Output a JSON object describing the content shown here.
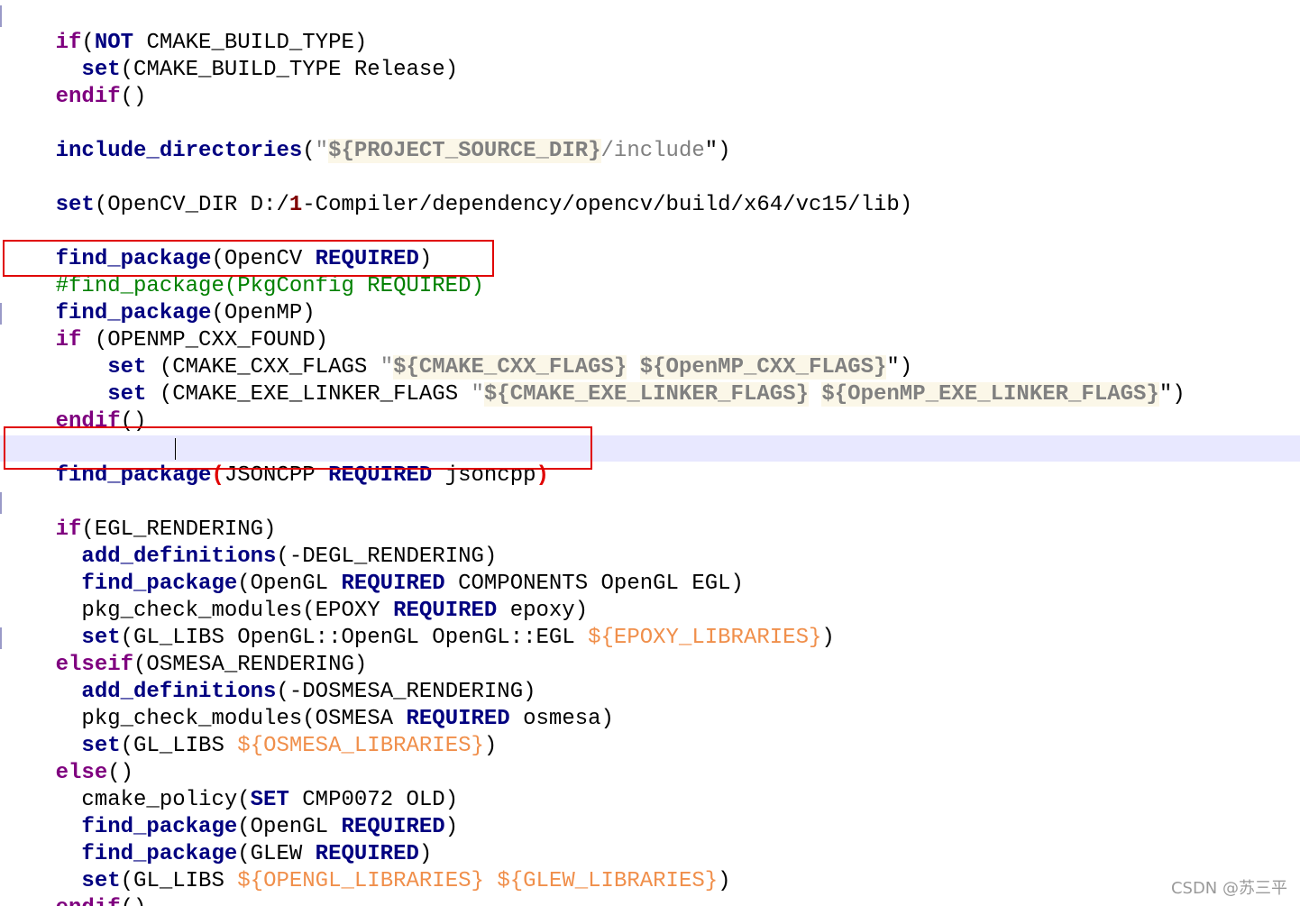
{
  "lines": [
    "if(NOT CMAKE_BUILD_TYPE)",
    "  set(CMAKE_BUILD_TYPE Release)",
    "endif()",
    "",
    "include_directories(\"${PROJECT_SOURCE_DIR}/include\")",
    "",
    "set(OpenCV_DIR D:/1-Compiler/dependency/opencv/build/x64/vc15/lib)",
    "",
    "find_package(OpenCV REQUIRED)",
    "#find_package(PkgConfig REQUIRED)",
    "find_package(OpenMP)",
    "if (OPENMP_CXX_FOUND)",
    "    set (CMAKE_CXX_FLAGS \"${CMAKE_CXX_FLAGS} ${OpenMP_CXX_FLAGS}\")",
    "    set (CMAKE_EXE_LINKER_FLAGS \"${CMAKE_EXE_LINKER_FLAGS} ${OpenMP_EXE_LINKER_FLAGS}\")",
    "endif()",
    "",
    "find_package(JSONCPP REQUIRED jsoncpp)",
    "",
    "if(EGL_RENDERING)",
    "  add_definitions(-DEGL_RENDERING)",
    "  find_package(OpenGL REQUIRED COMPONENTS OpenGL EGL)",
    "  pkg_check_modules(EPOXY REQUIRED epoxy)",
    "  set(GL_LIBS OpenGL::OpenGL OpenGL::EGL ${EPOXY_LIBRARIES})",
    "elseif(OSMESA_RENDERING)",
    "  add_definitions(-DOSMESA_RENDERING)",
    "  pkg_check_modules(OSMESA REQUIRED osmesa)",
    "  set(GL_LIBS ${OSMESA_LIBRARIES})",
    "else()",
    "  cmake_policy(SET CMP0072 OLD)",
    "  find_package(OpenGL REQUIRED)",
    "  find_package(GLEW REQUIRED)",
    "  set(GL_LIBS ${OPENGL_LIBRARIES} ${GLEW_LIBRARIES})",
    "endif()"
  ],
  "watermark": "CSDN @苏三平",
  "colors": {
    "keyword": "#000080",
    "control": "#7f007f",
    "comment": "#008000",
    "variable": "#f08f4b",
    "highlight_box": "#e00000"
  }
}
